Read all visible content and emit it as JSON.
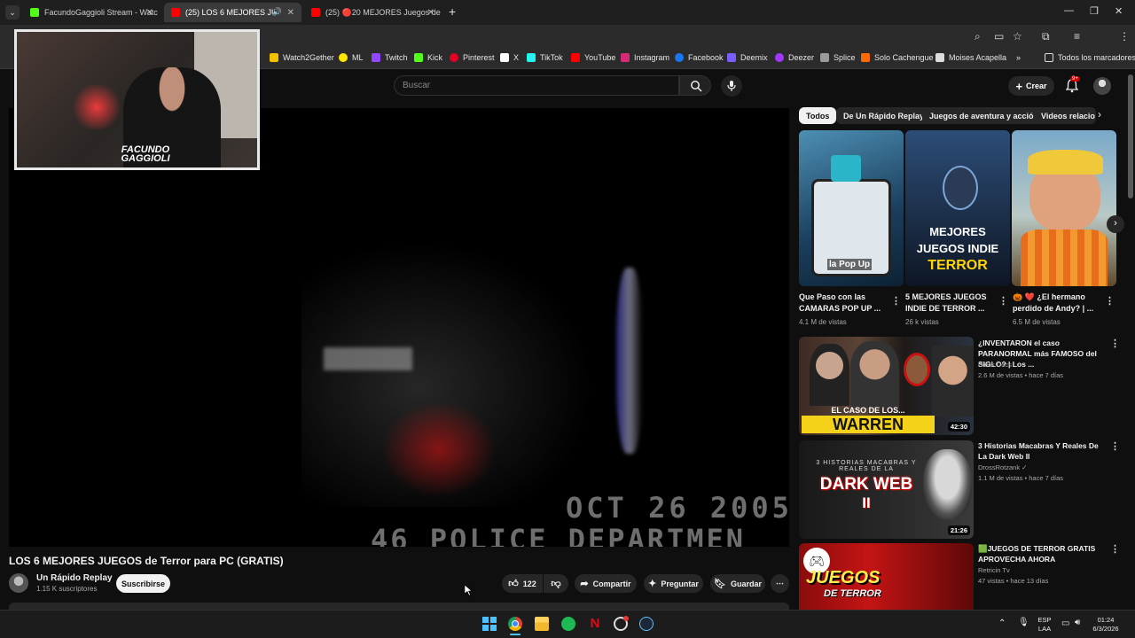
{
  "browser": {
    "tabs": [
      {
        "label": "FacundoGaggioli Stream - Watc",
        "active": false
      },
      {
        "label": "(25) LOS 6 MEJORES JUEGO",
        "active": true
      },
      {
        "label": "(25) 🔴20 MEJORES Juegos de",
        "active": false
      }
    ],
    "new_tab": "+",
    "bookmarks": [
      {
        "label": "Watch2Gether",
        "color": "#f2c200"
      },
      {
        "label": "ML",
        "color": "#ffe600"
      },
      {
        "label": "Twitch",
        "color": "#9146ff"
      },
      {
        "label": "Kick",
        "color": "#53fc18"
      },
      {
        "label": "Pinterest",
        "color": "#e60023"
      },
      {
        "label": "X",
        "color": "#ffffff"
      },
      {
        "label": "TikTok",
        "color": "#25f4ee"
      },
      {
        "label": "YouTube",
        "color": "#ff0000"
      },
      {
        "label": "Instagram",
        "color": "#d62976"
      },
      {
        "label": "Facebook",
        "color": "#1877f2"
      },
      {
        "label": "Deemix",
        "color": "#7a5cff"
      },
      {
        "label": "Deezer",
        "color": "#a238ff"
      },
      {
        "label": "Splice",
        "color": "#9a9a9a"
      },
      {
        "label": "Solo Cachengue",
        "color": "#ff6a00"
      },
      {
        "label": "Moises Acapella",
        "color": "#dddddd"
      }
    ],
    "all_bookmarks": "Todos los marcadores"
  },
  "youtube": {
    "search_placeholder": "Buscar",
    "create_label": "Crear",
    "notifications_badge": "9+"
  },
  "webcam": {
    "logo_line1": "FACUNDO",
    "logo_line2": "GAGGIOLI"
  },
  "video": {
    "osd_date": "OCT 26 2005",
    "osd_dept": "46 POLICE DEPARTMEN",
    "title": "LOS 6 MEJORES JUEGOS de Terror para PC (GRATIS)",
    "channel": "Un Rápido Replay",
    "subscribers": "1.15 K suscriptores",
    "subscribe_label": "Suscribirse",
    "likes": "122",
    "share_label": "Compartir",
    "ask_label": "Preguntar",
    "save_label": "Guardar"
  },
  "chips": [
    "Todos",
    "De Un Rápido Replay",
    "Juegos de aventura y acción",
    "Videos relacio"
  ],
  "shorts": [
    {
      "title": "Que Paso con las CAMARAS POP UP ...",
      "views": "4.1 M de vistas",
      "overlay": "la Pop Up"
    },
    {
      "title": "5 MEJORES JUEGOS INDIE DE TERROR ...",
      "views": "26 k vistas",
      "overlay1": "MEJORES",
      "overlay2": "JUEGOS INDIE",
      "overlay3": "TERROR"
    },
    {
      "title": "🎃 ❤️ ¿El hermano perdido de Andy? | ...",
      "views": "6.5 M de vistas"
    }
  ],
  "recommended": [
    {
      "title": "¿INVENTARON el caso PARANORMAL más FAMOSO del SIGLO? | Los ...",
      "channel": "Dieck Docs",
      "meta": "2.6 M de vistas • hace 7 días",
      "duration": "42:30",
      "overlay1": "EL CASO DE LOS...",
      "overlay2": "WARREN"
    },
    {
      "title": "3 Historias Macabras Y Reales De La Dark Web II",
      "channel": "DrossRotzank ✓",
      "meta": "1.1 M de vistas • hace 7 días",
      "duration": "21:26",
      "overlay1": "3 HISTORIAS MACABRAS Y REALES DE LA",
      "overlay2": "DARK WEB",
      "overlay3": "II"
    },
    {
      "title": "🟩JUEGOS DE TERROR GRATIS APROVECHA AHORA",
      "channel": "Retricin Tv",
      "meta": "47 vistas • hace 13 días",
      "overlay1": "JUEGOS",
      "overlay2": "DE TERROR"
    }
  ],
  "taskbar": {
    "lang1": "ESP",
    "lang2": "LAA",
    "time": "01:24",
    "date": "6/3/2026"
  },
  "colors": {
    "youtube_red": "#ff0000",
    "background": "#0f0f0f",
    "chip_bg": "#272727"
  }
}
